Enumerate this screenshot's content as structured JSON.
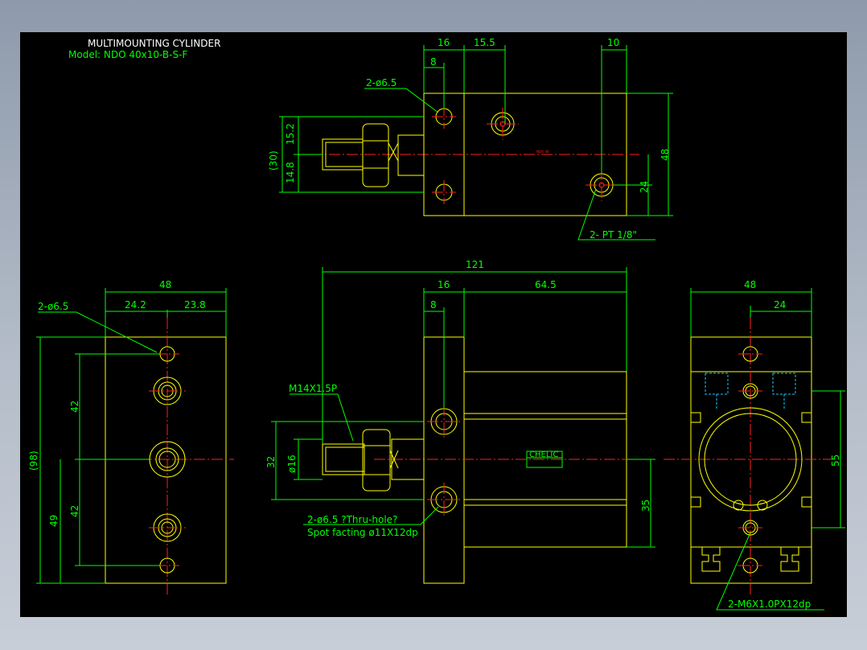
{
  "title": "MULTIMOUNTING CYLINDER",
  "model": "Model:  NDO 40x10-B-S-F",
  "badge_text": "CHELIC",
  "top_view": {
    "dims": [
      "16",
      "15.5",
      "10",
      "8",
      "2-ø6.5",
      "15.2",
      "14.8",
      "(30)",
      "48",
      "24",
      "2- PT 1/8\""
    ],
    "center_tag": "NDO 40"
  },
  "left_view": {
    "dims": [
      "48",
      "24.2",
      "23.8",
      "2-ø6.5",
      "42",
      "42",
      "(98)",
      "49"
    ]
  },
  "front_view": {
    "dims": [
      "121",
      "16",
      "64.5",
      "8",
      "M14X1.5P",
      "32",
      "ø16",
      "35",
      "2-ø6.5 ?Thru-hole?",
      "Spot facting  ø11X12dp"
    ]
  },
  "right_view": {
    "dims": [
      "48",
      "24",
      "55",
      "2-M6X1.0PX12dp"
    ]
  },
  "colors": {
    "background": "#000000",
    "dimension": "#00ff00",
    "object": "#ffff00",
    "centerline": "#ff2020",
    "hidden": "#19c6ff",
    "title": "#ffffff"
  }
}
